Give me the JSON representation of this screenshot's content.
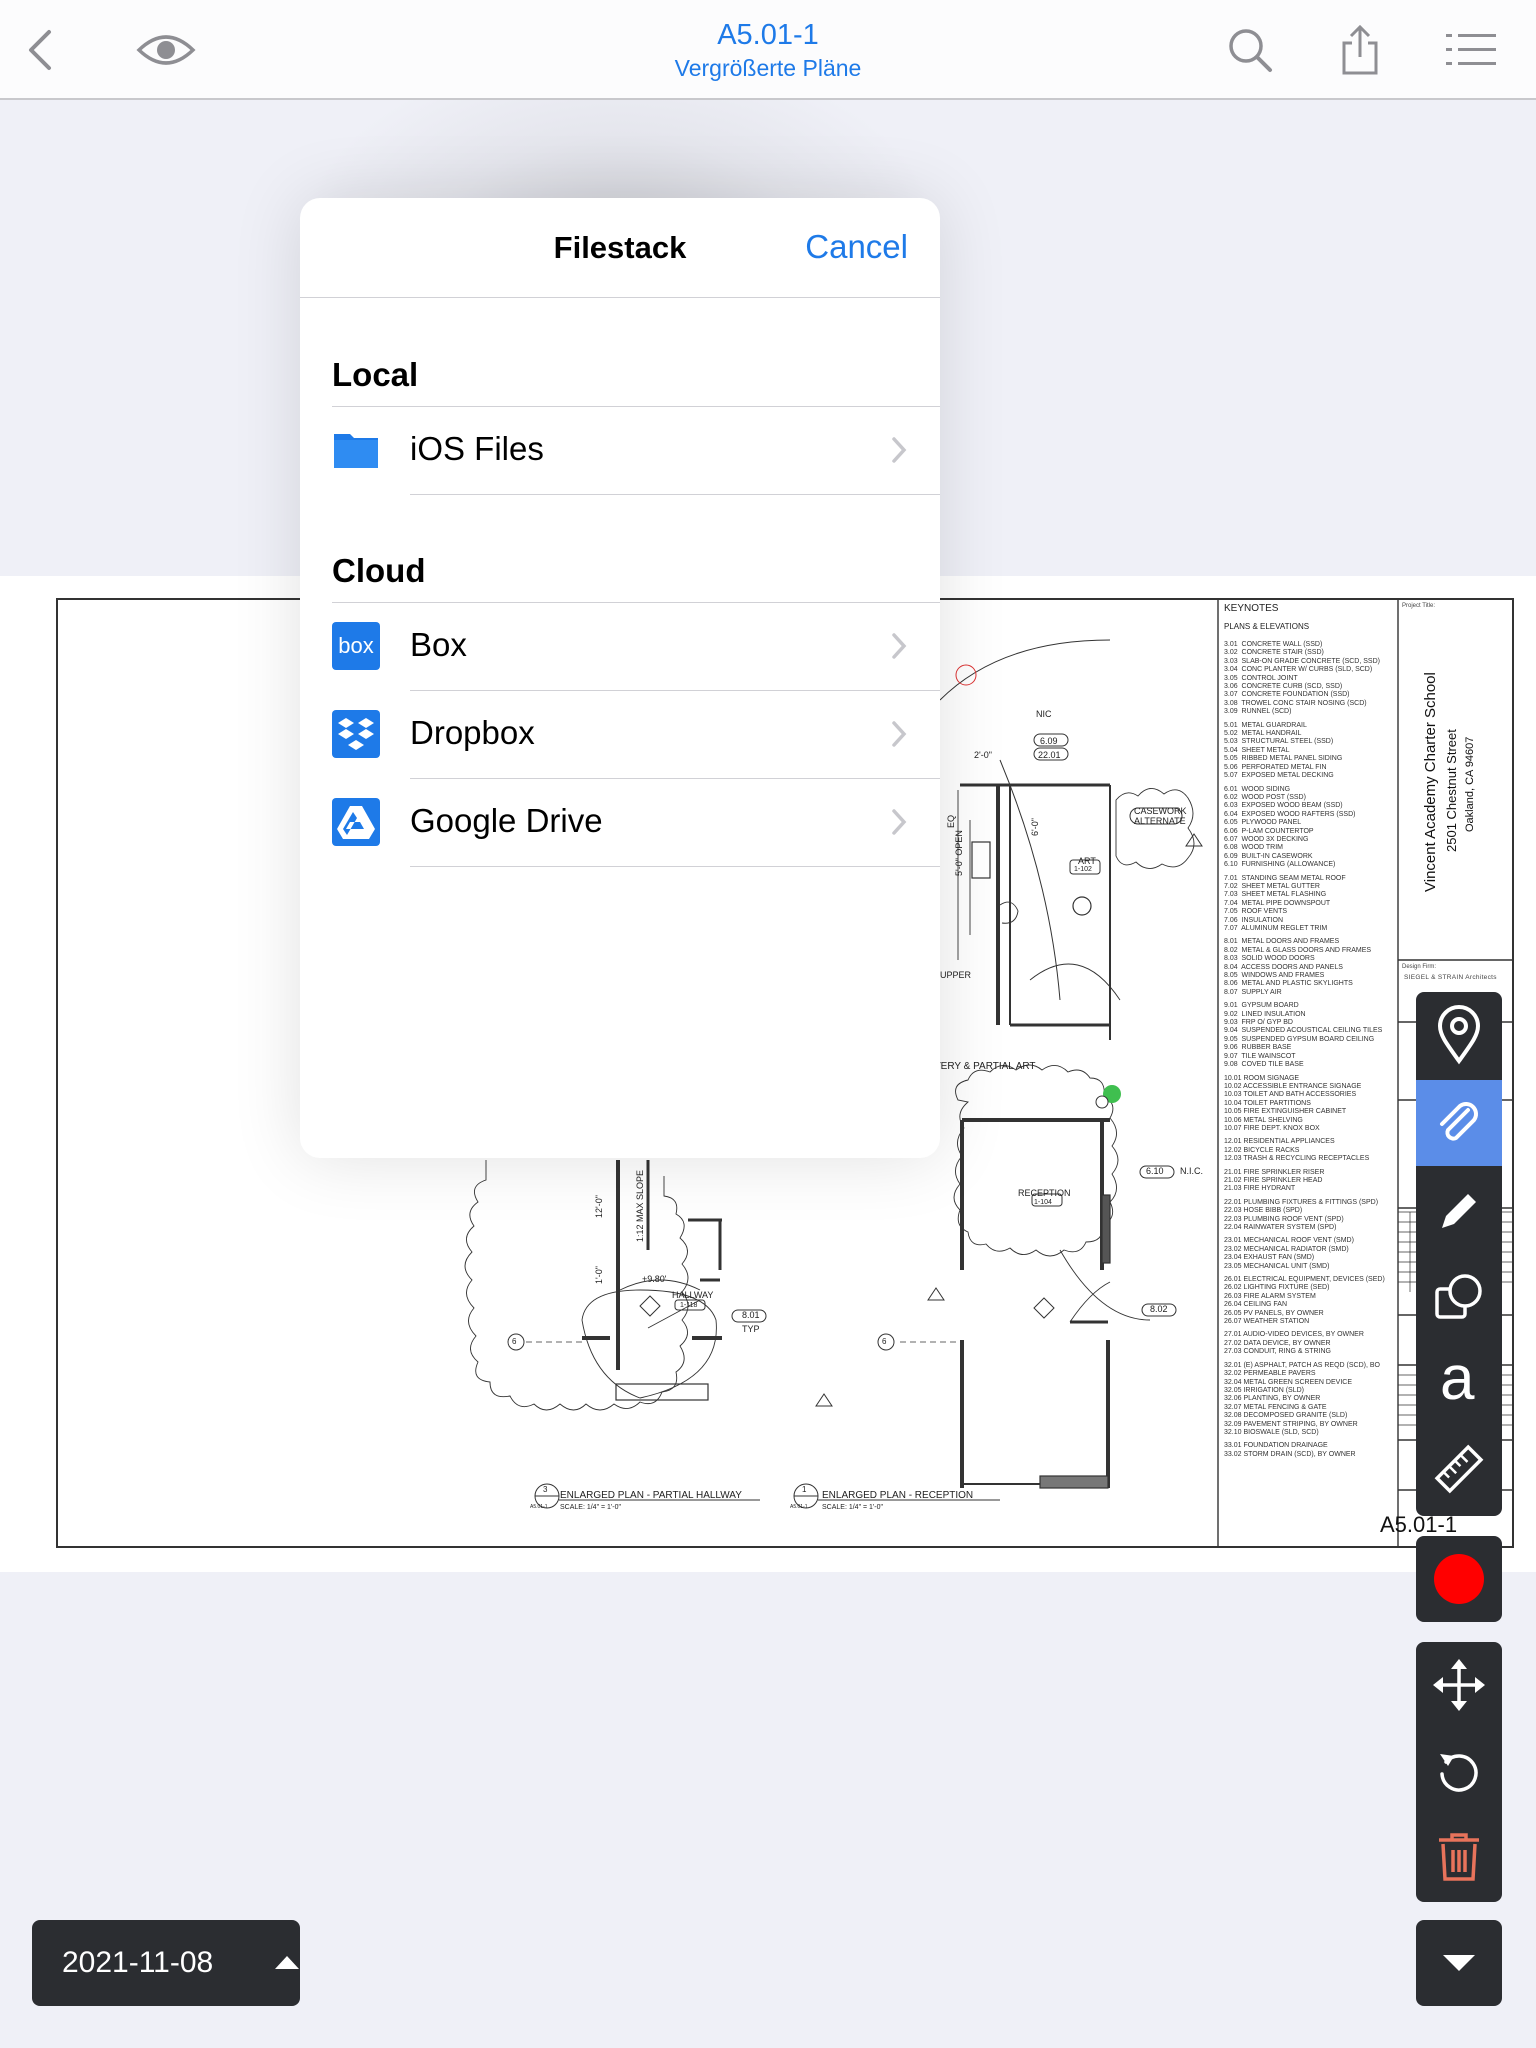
{
  "nav": {
    "title": "A5.01-1",
    "subtitle": "Vergrößerte Pläne"
  },
  "popover": {
    "title": "Filestack",
    "cancel_label": "Cancel",
    "sections": [
      {
        "label": "Local",
        "items": [
          {
            "label": "iOS Files",
            "icon": "folder-icon"
          }
        ]
      },
      {
        "label": "Cloud",
        "items": [
          {
            "label": "Box",
            "icon": "box-icon"
          },
          {
            "label": "Dropbox",
            "icon": "dropbox-icon"
          },
          {
            "label": "Google Drive",
            "icon": "google-drive-icon"
          }
        ]
      }
    ]
  },
  "drawing": {
    "keynotes_title": "KEYNOTES",
    "keynotes_heading": "PLANS & ELEVATIONS",
    "keynotes": [
      [
        "3.01  CONCRETE WALL (SSD)",
        "3.02  CONCRETE STAIR (SSD)",
        "3.03  SLAB-ON GRADE CONCRETE (SCD, SSD)",
        "3.04  CONC PLANTER W/ CURBS (SLD, SCD)",
        "3.05  CONTROL JOINT",
        "3.06  CONCRETE CURB (SCD, SSD)",
        "3.07  CONCRETE FOUNDATION (SSD)",
        "3.08  TROWEL CONC STAIR NOSING (SCD)",
        "3.09  RUNNEL (SCD)"
      ],
      [
        "5.01  METAL GUARDRAIL",
        "5.02  METAL HANDRAIL",
        "5.03  STRUCTURAL STEEL (SSD)",
        "5.04  SHEET METAL",
        "5.05  RIBBED METAL PANEL SIDING",
        "5.06  PERFORATED METAL FIN",
        "5.07  EXPOSED METAL DECKING"
      ],
      [
        "6.01  WOOD SIDING",
        "6.02  WOOD POST (SSD)",
        "6.03  EXPOSED WOOD BEAM (SSD)",
        "6.04  EXPOSED WOOD RAFTERS (SSD)",
        "6.05  PLYWOOD PANEL",
        "6.06  P-LAM COUNTERTOP",
        "6.07  WOOD 3X DECKING",
        "6.08  WOOD TRIM",
        "6.09  BUILT-IN CASEWORK",
        "6.10  FURNISHING (ALLOWANCE)"
      ],
      [
        "7.01  STANDING SEAM METAL ROOF",
        "7.02  SHEET METAL GUTTER",
        "7.03  SHEET METAL FLASHING",
        "7.04  METAL PIPE DOWNSPOUT",
        "7.05  ROOF VENTS",
        "7.06  INSULATION",
        "7.07  ALUMINUM REGLET TRIM"
      ],
      [
        "8.01  METAL DOORS AND FRAMES",
        "8.02  METAL & GLASS DOORS AND FRAMES",
        "8.03  SOLID WOOD DOORS",
        "8.04  ACCESS DOORS AND PANELS",
        "8.05  WINDOWS AND FRAMES",
        "8.06  METAL AND PLASTIC SKYLIGHTS",
        "8.07  SUPPLY AIR"
      ],
      [
        "9.01  GYPSUM BOARD",
        "9.02  LINED INSULATION",
        "9.03  FRP O/ GYP BD",
        "9.04  SUSPENDED ACOUSTICAL CEILING TILES",
        "9.05  SUSPENDED GYPSUM BOARD CEILING",
        "9.06  RUBBER BASE",
        "9.07  TILE WAINSCOT",
        "9.08  COVED TILE BASE"
      ],
      [
        "10.01 ROOM SIGNAGE",
        "10.02 ACCESSIBLE ENTRANCE SIGNAGE",
        "10.03 TOILET AND BATH ACCESSORIES",
        "10.04 TOILET PARTITIONS",
        "10.05 FIRE EXTINGUISHER CABINET",
        "10.06 METAL SHELVING",
        "10.07 FIRE DEPT. KNOX BOX"
      ],
      [
        "12.01 RESIDENTIAL APPLIANCES",
        "12.02 BICYCLE RACKS",
        "12.03 TRASH & RECYCLING RECEPTACLES"
      ],
      [
        "21.01 FIRE SPRINKLER RISER",
        "21.02 FIRE SPRINKLER HEAD",
        "21.03 FIRE HYDRANT"
      ],
      [
        "22.01 PLUMBING FIXTURES & FITTINGS (SPD)",
        "22.03 HOSE BIBB (SPD)",
        "22.03 PLUMBING ROOF VENT (SPD)",
        "22.04 RAINWATER SYSTEM (SPD)"
      ],
      [
        "23.01 MECHANICAL ROOF VENT (SMD)",
        "23.02 MECHANICAL RADIATOR (SMD)",
        "23.04 EXHAUST FAN (SMD)",
        "23.05 MECHANICAL UNIT (SMD)"
      ],
      [
        "26.01 ELECTRICAL EQUIPMENT, DEVICES (SED)",
        "26.02 LIGHTING FIXTURE (SED)",
        "26.03 FIRE ALARM SYSTEM",
        "26.04 CEILING FAN",
        "26.05 PV PANELS, BY OWNER",
        "26.07 WEATHER STATION"
      ],
      [
        "27.01 AUDIO-VIDEO DEVICES, BY OWNER",
        "27.02 DATA DEVICE, BY OWNER",
        "27.03 CONDUIT, RING & STRING"
      ],
      [
        "32.01 (E) ASPHALT, PATCH AS REQD (SCD), BO",
        "32.02 PERMEABLE PAVERS",
        "32.04 METAL GREEN SCREEN DEVICE",
        "32.05 IRRIGATION (SLD)",
        "32.06 PLANTING, BY OWNER",
        "32.07 METAL FENCING & GATE",
        "32.08 DECOMPOSED GRANITE (SLD)",
        "32.09 PAVEMENT STRIPING, BY OWNER",
        "32.10 BIOSWALE (SLD, SCD)"
      ],
      [
        "33.01 FOUNDATION DRAINAGE",
        "33.02 STORM DRAIN (SCD), BY OWNER"
      ]
    ],
    "project_title_label": "Project Title:",
    "project_name": "Vincent Academy Charter School",
    "project_street": "2501 Chestnut Street",
    "project_city": "Oakland, CA 94607",
    "design_firm_label": "Design Firm:",
    "design_firm": "SIEGEL & STRAIN Architects",
    "sheet_number": "A5.01-1",
    "labels": {
      "nic": "NIC",
      "nic2": "N.I.C.",
      "casework": "CASEWORK",
      "alternate": "ALTERNATE",
      "art": "ART",
      "art_no": "1-102",
      "upper": "UPPER",
      "delivery": "VERY & PARTIAL ART",
      "reception": "RECEPTION",
      "reception_no": "1-104",
      "hallway": "HALLWAY",
      "hallway_no": "1-118",
      "slope": "1:12 MAX SLOPE",
      "elev": "+9.80'",
      "dim_12": "12'-0\"",
      "dim_1": "1'-0\"",
      "dim_5": "5'-0\" OPEN",
      "dim_6": "6'-0\"",
      "dim_2": "2'-0\"",
      "eq": "EQ",
      "typ": "TYP",
      "tag_609": "6.09",
      "tag_2201": "22.01",
      "tag_610": "6.10",
      "tag_801": "8.01",
      "tag_802": "8.02",
      "plan3_title": "ENLARGED PLAN - PARTIAL HALLWAY",
      "plan1_title": "ENLARGED PLAN - RECEPTION",
      "scale": "SCALE: 1/4\" = 1'-0\"",
      "plan3_num": "3",
      "plan1_num": "1",
      "sheet_ref": "A5.01-1",
      "grid_6": "6"
    }
  },
  "toolbar": {
    "date": "2021-11-08"
  },
  "colors": {
    "accent": "#1e7ae8",
    "toolbar_bg": "#2b2d31",
    "active_tool": "#5b8de8",
    "record": "#ff0000",
    "delete": "#e8735b"
  }
}
